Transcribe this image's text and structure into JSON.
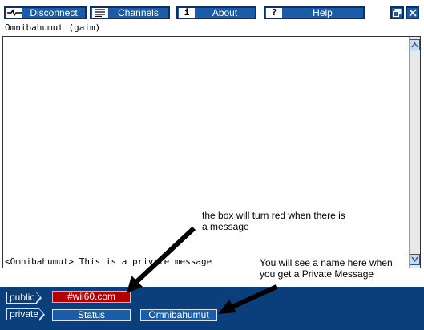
{
  "toolbar": {
    "disconnect_label": "Disconnect",
    "channels_label": "Channels",
    "about_label": "About",
    "help_label": "Help",
    "about_icon": "i",
    "help_icon": "?"
  },
  "channel": {
    "title": "Omnibahumut (gaim)"
  },
  "messages": [
    {
      "text": "<Omnibahumut> This is a private message"
    }
  ],
  "input": {
    "value": ""
  },
  "bottom_bar": {
    "public_label": "public",
    "private_label": "private",
    "public_channel": "#wii60.com",
    "status_label": "Status",
    "private_user": "Omnibahumut"
  },
  "annotations": {
    "red_box_note_1": "the box will turn red when there is",
    "red_box_note_2": "a message",
    "private_note_1": "You will see a name here when",
    "private_note_2": "you get a Private Message"
  },
  "colors": {
    "accent_blue": "#1a5ca8",
    "bottom_bar": "#0a3f7c",
    "alert_red": "#b30000"
  }
}
